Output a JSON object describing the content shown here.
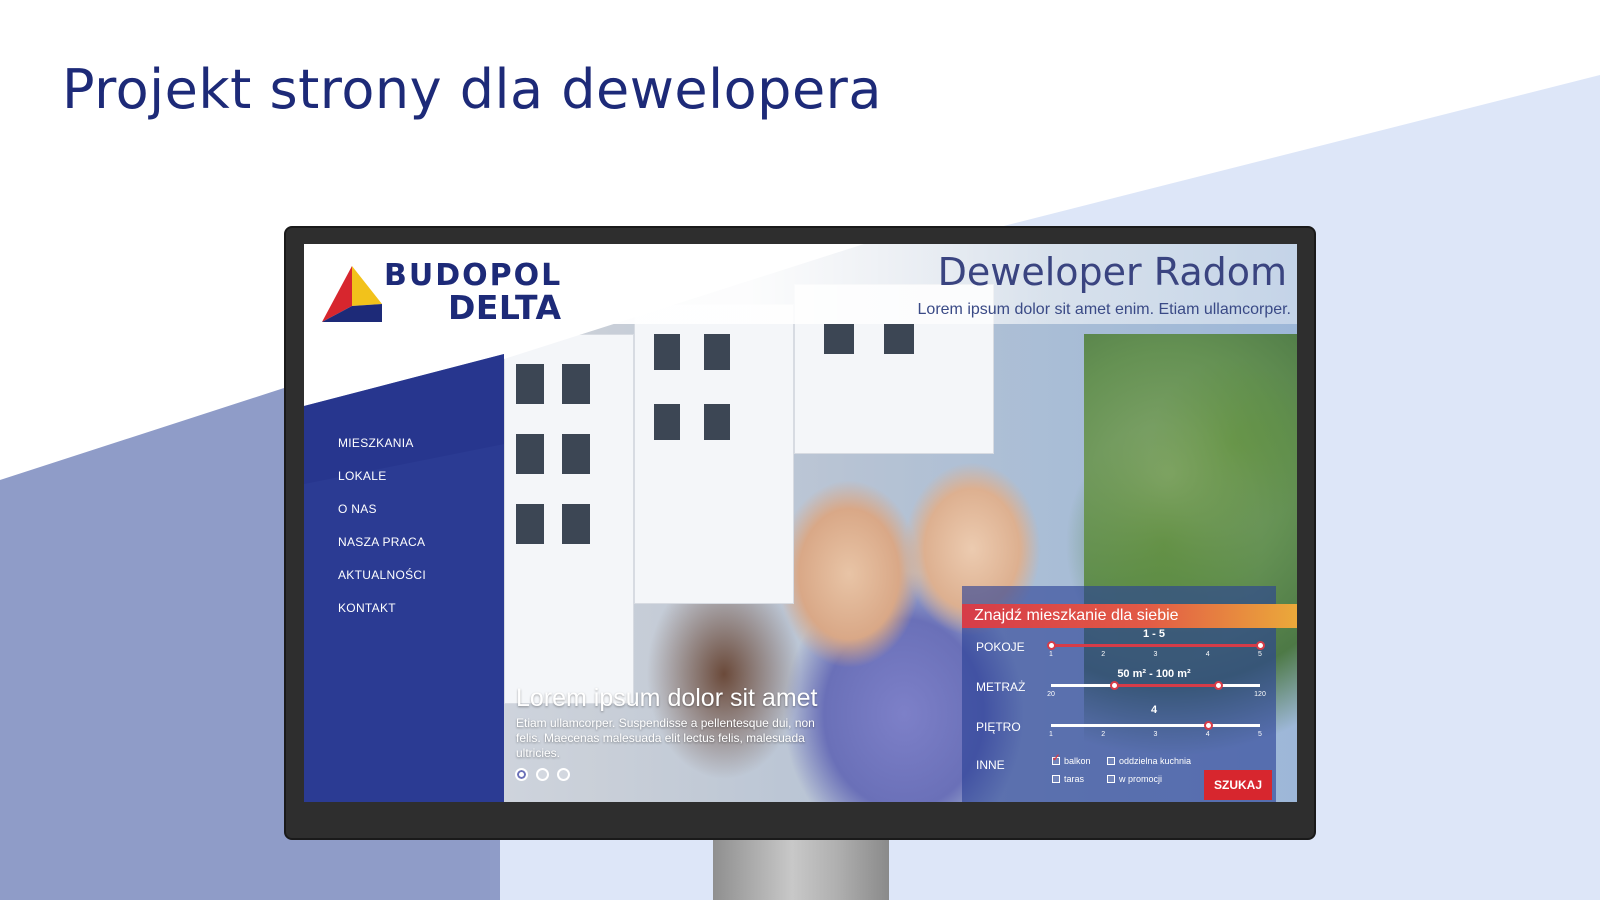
{
  "slide": {
    "title": "Projekt strony dla dewelopera"
  },
  "colors": {
    "brand_navy": "#1d2a78",
    "sidebar_blue": "#2b3b93",
    "accent_red": "#d63c48",
    "accent_yellow": "#eba93a",
    "bg_light_blue": "#dde6f8",
    "bg_slate": "#8f9cc8"
  },
  "site": {
    "logo": {
      "line1": "BUDOPOL",
      "line2": "DELTA",
      "icon": "triangle-logo-icon"
    },
    "header": {
      "title": "Deweloper Radom",
      "subtitle": "Lorem ipsum dolor sit amet enim. Etiam ullamcorper."
    },
    "nav": [
      {
        "label": "MIESZKANIA"
      },
      {
        "label": "LOKALE"
      },
      {
        "label": "O NAS"
      },
      {
        "label": "NASZA PRACA"
      },
      {
        "label": "AKTUALNOŚCI"
      },
      {
        "label": "KONTAKT"
      }
    ],
    "hero": {
      "title": "Lorem ipsum dolor sit amet",
      "body": "Etiam ullamcorper. Suspendisse a pellentesque dui, non felis. Maecenas malesuada elit lectus felis, malesuada ultricies.",
      "slides": 3,
      "active_slide": 1
    },
    "search": {
      "heading": "Znajdź mieszkanie dla siebie",
      "rooms": {
        "label": "POKOJE",
        "value": "1 - 5",
        "ticks": [
          "1",
          "2",
          "3",
          "4",
          "5"
        ],
        "min": 1,
        "max": 5,
        "low": 1,
        "high": 5
      },
      "area": {
        "label": "METRAŻ",
        "value": "50 m² - 100 m²",
        "ticks": [
          "20",
          "120"
        ],
        "min": 20,
        "max": 120,
        "low": 50,
        "high": 100
      },
      "floor": {
        "label": "PIĘTRO",
        "value": "4",
        "ticks": [
          "1",
          "2",
          "3",
          "4",
          "5"
        ],
        "min": 1,
        "max": 5,
        "selected": 4
      },
      "other": {
        "label": "INNE",
        "options": [
          {
            "label": "balkon",
            "checked": true
          },
          {
            "label": "oddzielna kuchnia",
            "checked": false
          },
          {
            "label": "taras",
            "checked": false
          },
          {
            "label": "w promocji",
            "checked": false
          }
        ]
      },
      "button": "SZUKAJ"
    }
  }
}
